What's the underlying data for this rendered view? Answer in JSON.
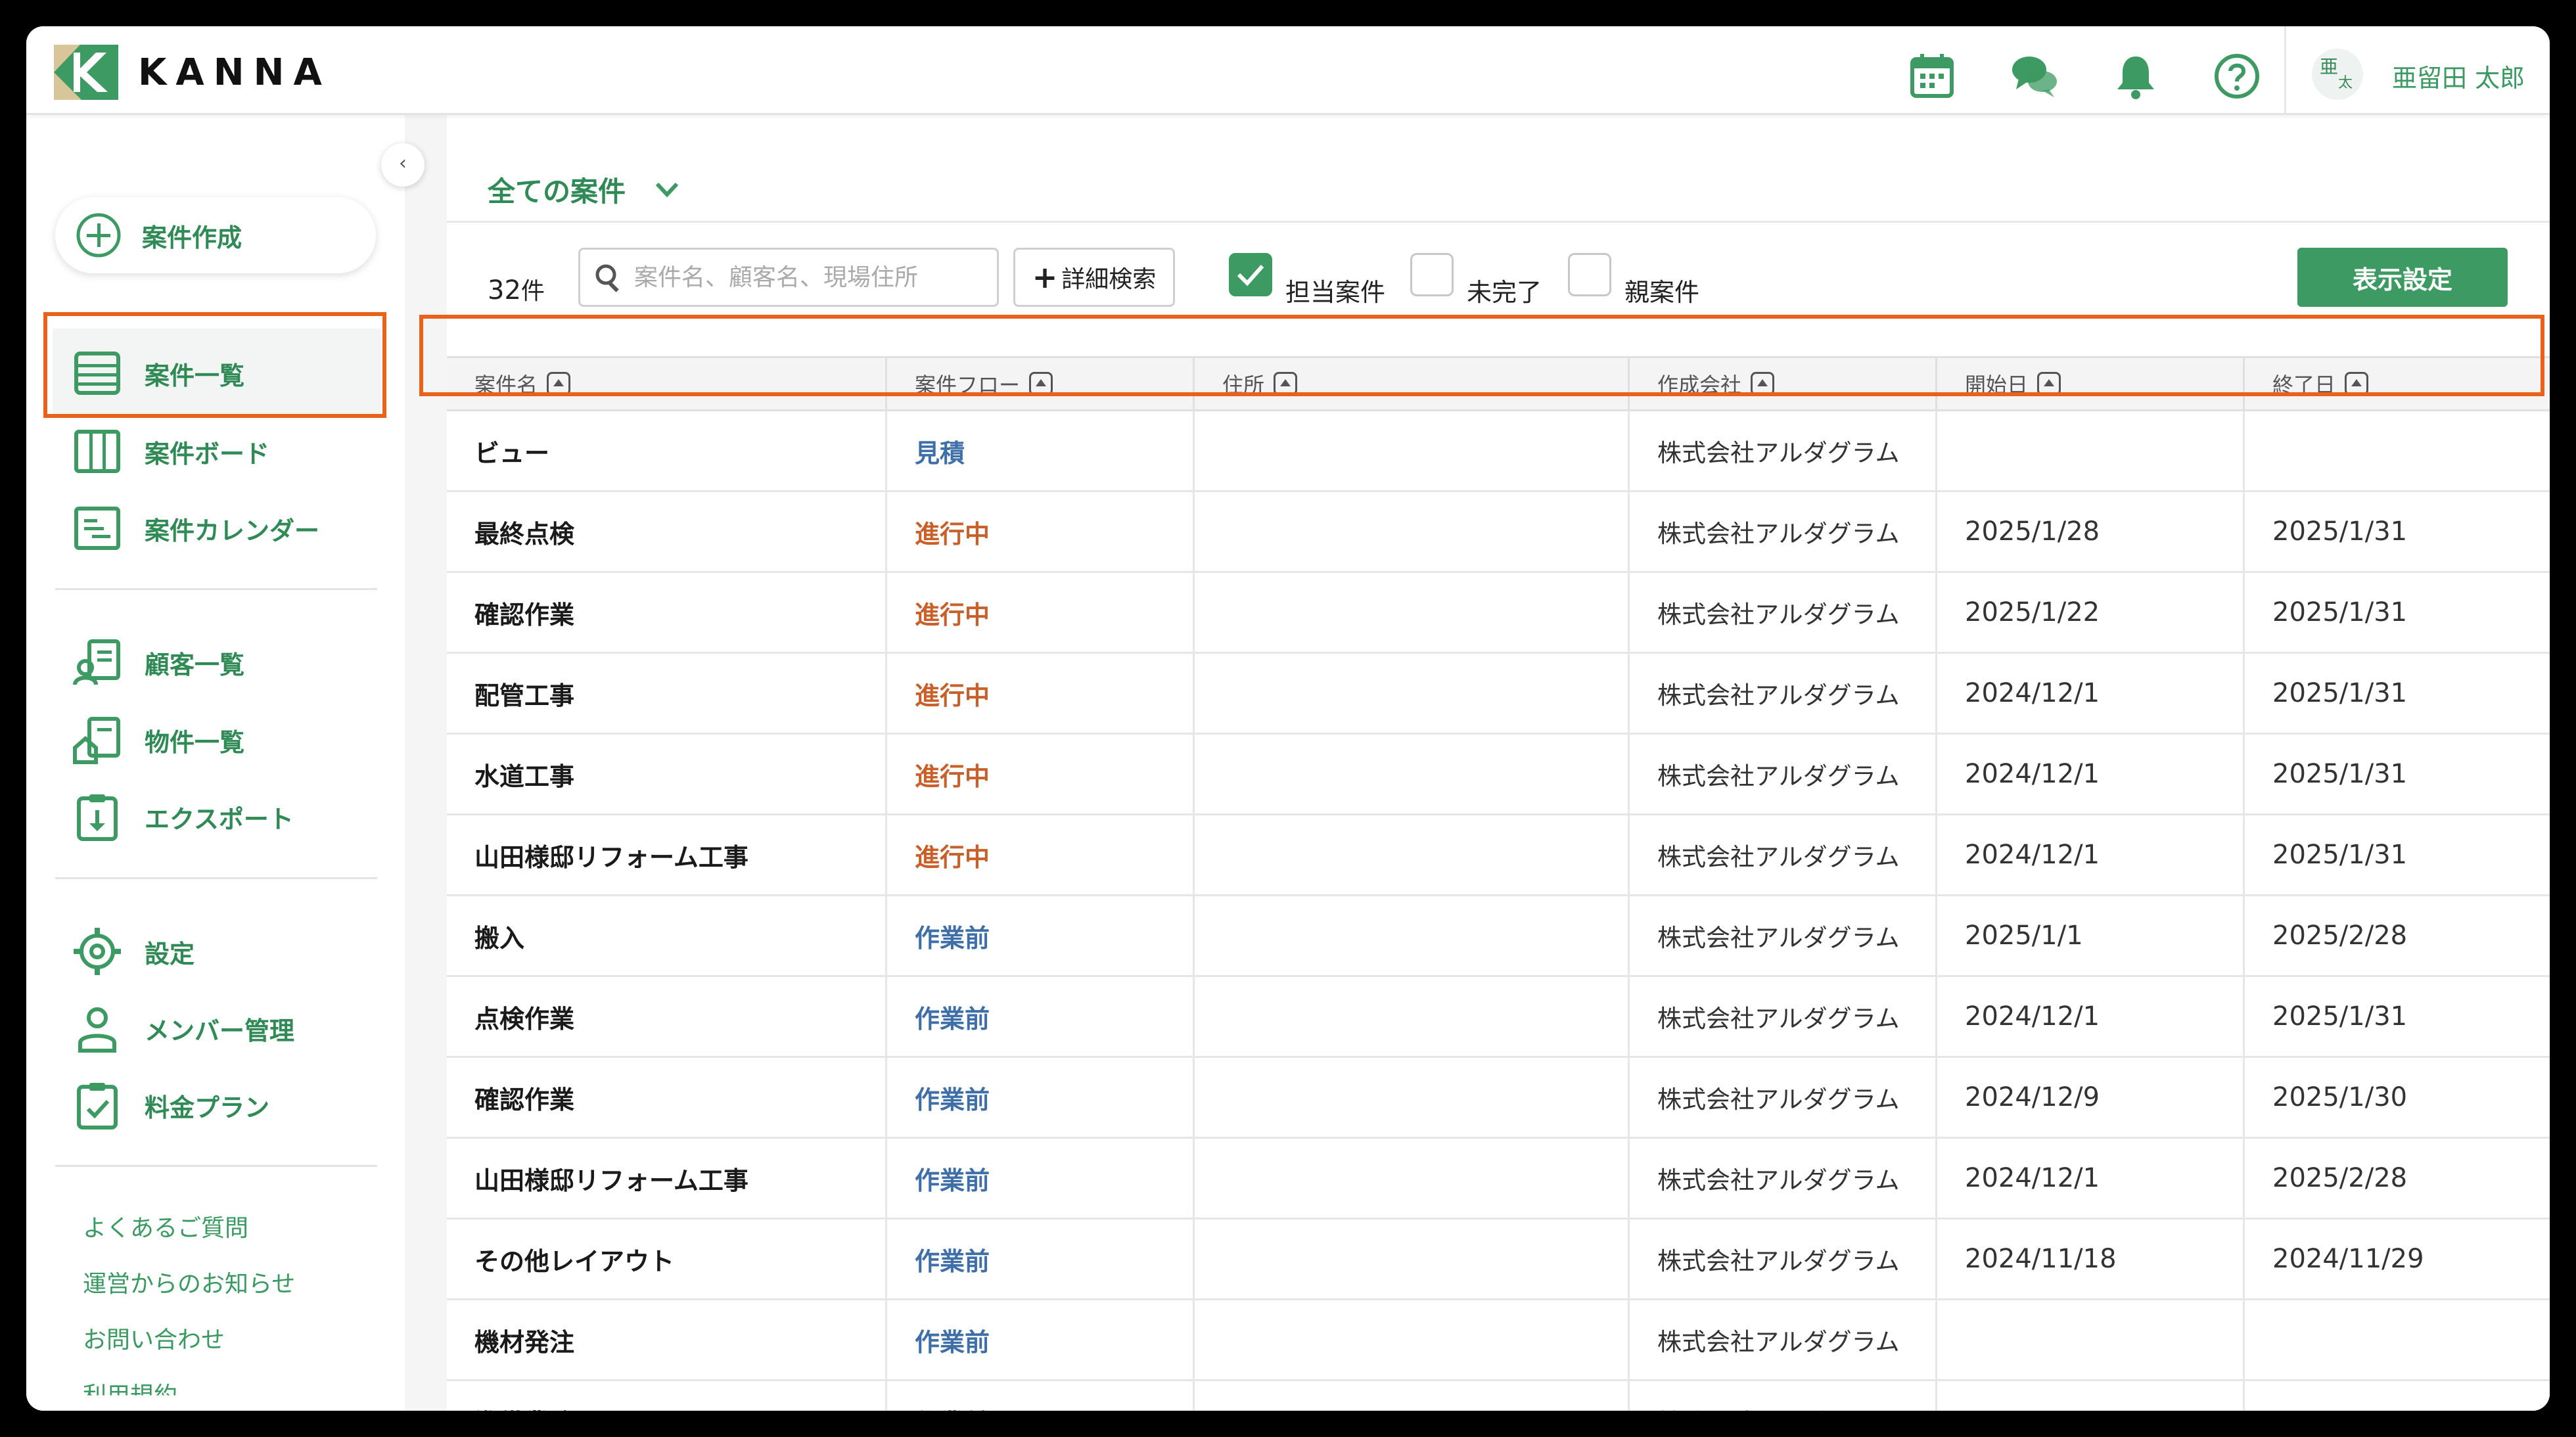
{
  "app": {
    "logo_text": "KANNA",
    "user_name": "亜留田 太郎",
    "avatar_chars": [
      "亜",
      "太"
    ],
    "brand_color": "#3c9a62",
    "highlight_color": "#e8621a",
    "top_icons": [
      "calendar-icon",
      "chat-icon",
      "bell-icon",
      "help-icon"
    ]
  },
  "sidebar": {
    "create_label": "案件作成",
    "items": [
      {
        "label": "案件一覧",
        "icon": "list-icon"
      },
      {
        "label": "案件ボード",
        "icon": "board-icon"
      },
      {
        "label": "案件カレンダー",
        "icon": "calendar-list-icon"
      },
      {
        "label": "顧客一覧",
        "icon": "customer-icon"
      },
      {
        "label": "物件一覧",
        "icon": "property-icon"
      },
      {
        "label": "エクスポート",
        "icon": "export-icon"
      },
      {
        "label": "設定",
        "icon": "gear-icon"
      },
      {
        "label": "メンバー管理",
        "icon": "member-icon"
      },
      {
        "label": "料金プラン",
        "icon": "plan-icon"
      }
    ],
    "footer_links": [
      "よくあるご質問",
      "運営からのお知らせ",
      "お問い合わせ",
      "利用規約"
    ]
  },
  "main": {
    "view_title": "全ての案件",
    "count_number": "32",
    "count_unit": "件",
    "search_placeholder": "案件名、顧客名、現場住所",
    "advanced_search_label": "詳細検索",
    "filters": [
      {
        "label": "担当案件",
        "checked": true
      },
      {
        "label": "未完了",
        "checked": false
      },
      {
        "label": "親案件",
        "checked": false
      }
    ],
    "display_settings_label": "表示設定"
  },
  "table": {
    "columns": [
      "案件名",
      "案件フロー",
      "住所",
      "作成会社",
      "開始日",
      "終了日"
    ],
    "rows": [
      {
        "name": "ビュー",
        "flow": "見積",
        "flow_color": "#3f6fa8",
        "address": "",
        "company": "株式会社アルダグラム",
        "start": "",
        "end": ""
      },
      {
        "name": "最終点検",
        "flow": "進行中",
        "flow_color": "#c9602a",
        "address": "",
        "company": "株式会社アルダグラム",
        "start": "2025/1/28",
        "end": "2025/1/31"
      },
      {
        "name": "確認作業",
        "flow": "進行中",
        "flow_color": "#c9602a",
        "address": "",
        "company": "株式会社アルダグラム",
        "start": "2025/1/22",
        "end": "2025/1/31"
      },
      {
        "name": "配管工事",
        "flow": "進行中",
        "flow_color": "#c9602a",
        "address": "",
        "company": "株式会社アルダグラム",
        "start": "2024/12/1",
        "end": "2025/1/31"
      },
      {
        "name": "水道工事",
        "flow": "進行中",
        "flow_color": "#c9602a",
        "address": "",
        "company": "株式会社アルダグラム",
        "start": "2024/12/1",
        "end": "2025/1/31"
      },
      {
        "name": "山田様邸リフォーム工事",
        "flow": "進行中",
        "flow_color": "#c9602a",
        "address": "",
        "company": "株式会社アルダグラム",
        "start": "2024/12/1",
        "end": "2025/1/31"
      },
      {
        "name": "搬入",
        "flow": "作業前",
        "flow_color": "#3f6fa8",
        "address": "",
        "company": "株式会社アルダグラム",
        "start": "2025/1/1",
        "end": "2025/2/28"
      },
      {
        "name": "点検作業",
        "flow": "作業前",
        "flow_color": "#3f6fa8",
        "address": "",
        "company": "株式会社アルダグラム",
        "start": "2024/12/1",
        "end": "2025/1/31"
      },
      {
        "name": "確認作業",
        "flow": "作業前",
        "flow_color": "#3f6fa8",
        "address": "",
        "company": "株式会社アルダグラム",
        "start": "2024/12/9",
        "end": "2025/1/30"
      },
      {
        "name": "山田様邸リフォーム工事",
        "flow": "作業前",
        "flow_color": "#3f6fa8",
        "address": "",
        "company": "株式会社アルダグラム",
        "start": "2024/12/1",
        "end": "2025/2/28"
      },
      {
        "name": "その他レイアウト",
        "flow": "作業前",
        "flow_color": "#3f6fa8",
        "address": "",
        "company": "株式会社アルダグラム",
        "start": "2024/11/18",
        "end": "2024/11/29"
      },
      {
        "name": "機材発注",
        "flow": "作業前",
        "flow_color": "#3f6fa8",
        "address": "",
        "company": "株式会社アルダグラム",
        "start": "",
        "end": ""
      },
      {
        "name": "準備業務",
        "flow": "作業前",
        "flow_color": "#3f6fa8",
        "address": "",
        "company": "株式会社アルダグラム",
        "start": "",
        "end": ""
      }
    ]
  }
}
